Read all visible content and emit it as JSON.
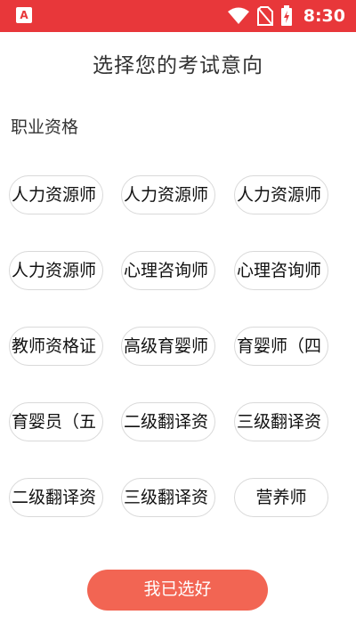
{
  "status_bar": {
    "app_icon_glyph": "A",
    "time": "8:30",
    "icons": [
      "wifi-icon",
      "no-sim-icon",
      "battery-charging-icon"
    ]
  },
  "page": {
    "title": "选择您的考试意向",
    "section_label": "职业资格",
    "options": [
      {
        "label": "人力资源师",
        "selected": false
      },
      {
        "label": "人力资源师",
        "selected": false
      },
      {
        "label": "人力资源师",
        "selected": false
      },
      {
        "label": "人力资源师",
        "selected": false
      },
      {
        "label": "心理咨询师",
        "selected": false
      },
      {
        "label": "心理咨询师",
        "selected": false
      },
      {
        "label": "教师资格证",
        "selected": false
      },
      {
        "label": "高级育婴师",
        "selected": false
      },
      {
        "label": "育婴师（四",
        "selected": false
      },
      {
        "label": "育婴员（五",
        "selected": false
      },
      {
        "label": "二级翻译资",
        "selected": false
      },
      {
        "label": "三级翻译资",
        "selected": false
      },
      {
        "label": "二级翻译资",
        "selected": false
      },
      {
        "label": "三级翻译资",
        "selected": false
      },
      {
        "label": "营养师",
        "selected": false
      }
    ],
    "confirm_label": "我已选好"
  },
  "colors": {
    "status_bar": "#e8373a",
    "confirm_button": "#f26553",
    "chip_border": "#d9d9d9",
    "text": "#333333"
  }
}
